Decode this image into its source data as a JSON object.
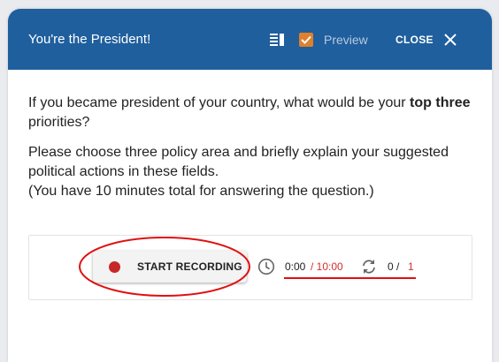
{
  "dialog": {
    "title": "You're the President!",
    "preview_label": "Preview",
    "preview_checked": true,
    "close_label": "CLOSE",
    "header_color": "#1f5f9d",
    "checkbox_color": "#e07f2c"
  },
  "question": {
    "prefix": "If you became president of your country, what would be your ",
    "bold": "top three",
    "suffix": " priorities?",
    "instructions": "Please choose three policy area and briefly explain your suggested political actions in these fields.",
    "time_note": "(You have 10 minutes total for answering the question.)"
  },
  "recorder": {
    "button_label": "START RECORDING",
    "time_current": "0:00",
    "time_max": "/ 10:00",
    "attempts_current": "0 /",
    "attempts_max": "1",
    "icons": [
      "record-dot-icon",
      "clock-icon",
      "repeat-icon"
    ]
  },
  "annotations": {
    "color": "#e01010"
  }
}
